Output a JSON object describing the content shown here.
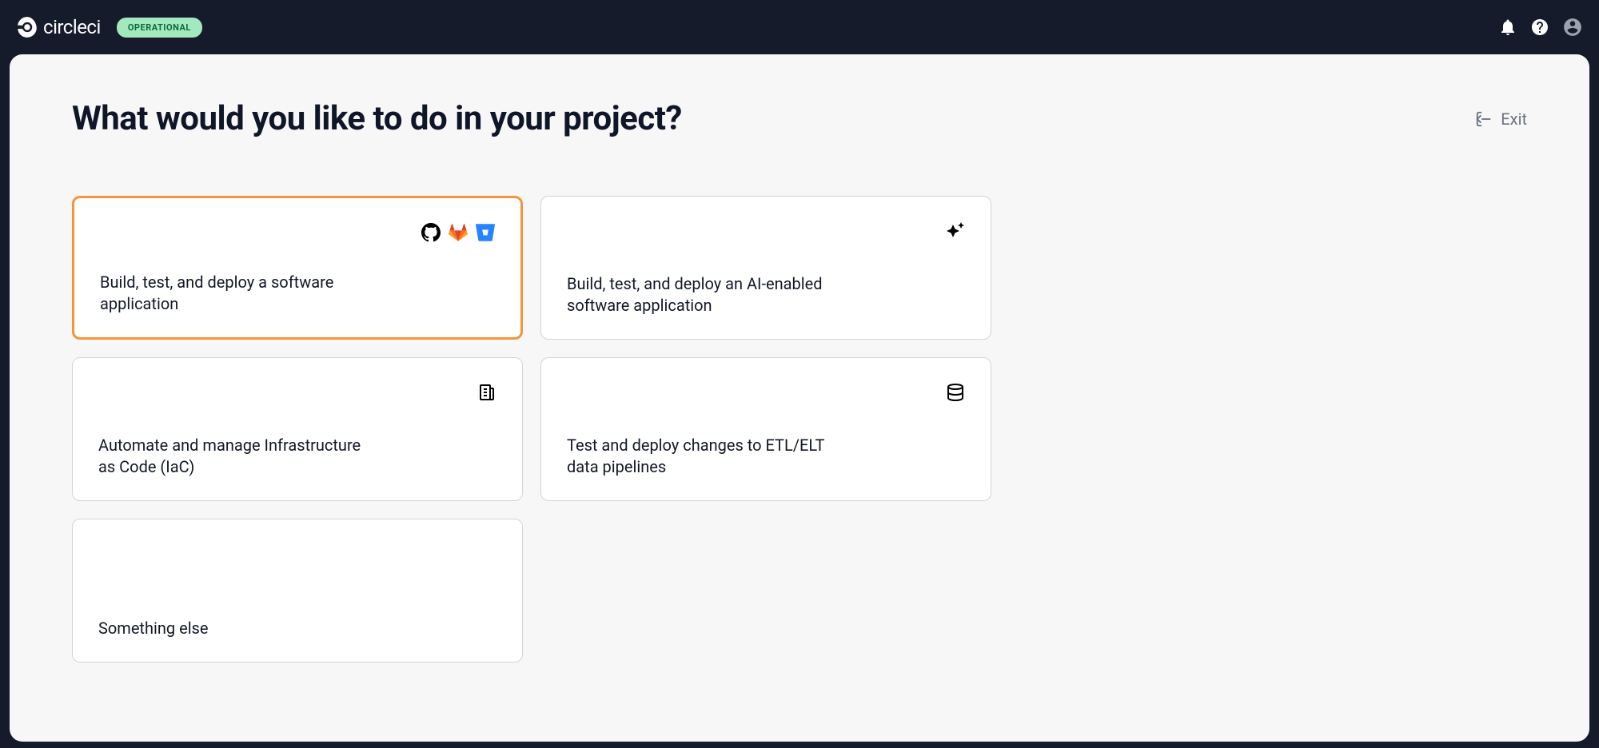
{
  "header": {
    "logo_text": "circleci",
    "status_badge": "OPERATIONAL"
  },
  "page": {
    "title": "What would you like to do in your project?",
    "exit_label": "Exit"
  },
  "options": {
    "build_deploy": "Build, test, and deploy a software application",
    "ai_enabled": "Build, test, and deploy an AI-enabled software application",
    "iac": "Automate and manage Infrastructure as Code (IaC)",
    "etl": "Test and deploy changes to ETL/ELT data pipelines",
    "other": "Something else"
  }
}
